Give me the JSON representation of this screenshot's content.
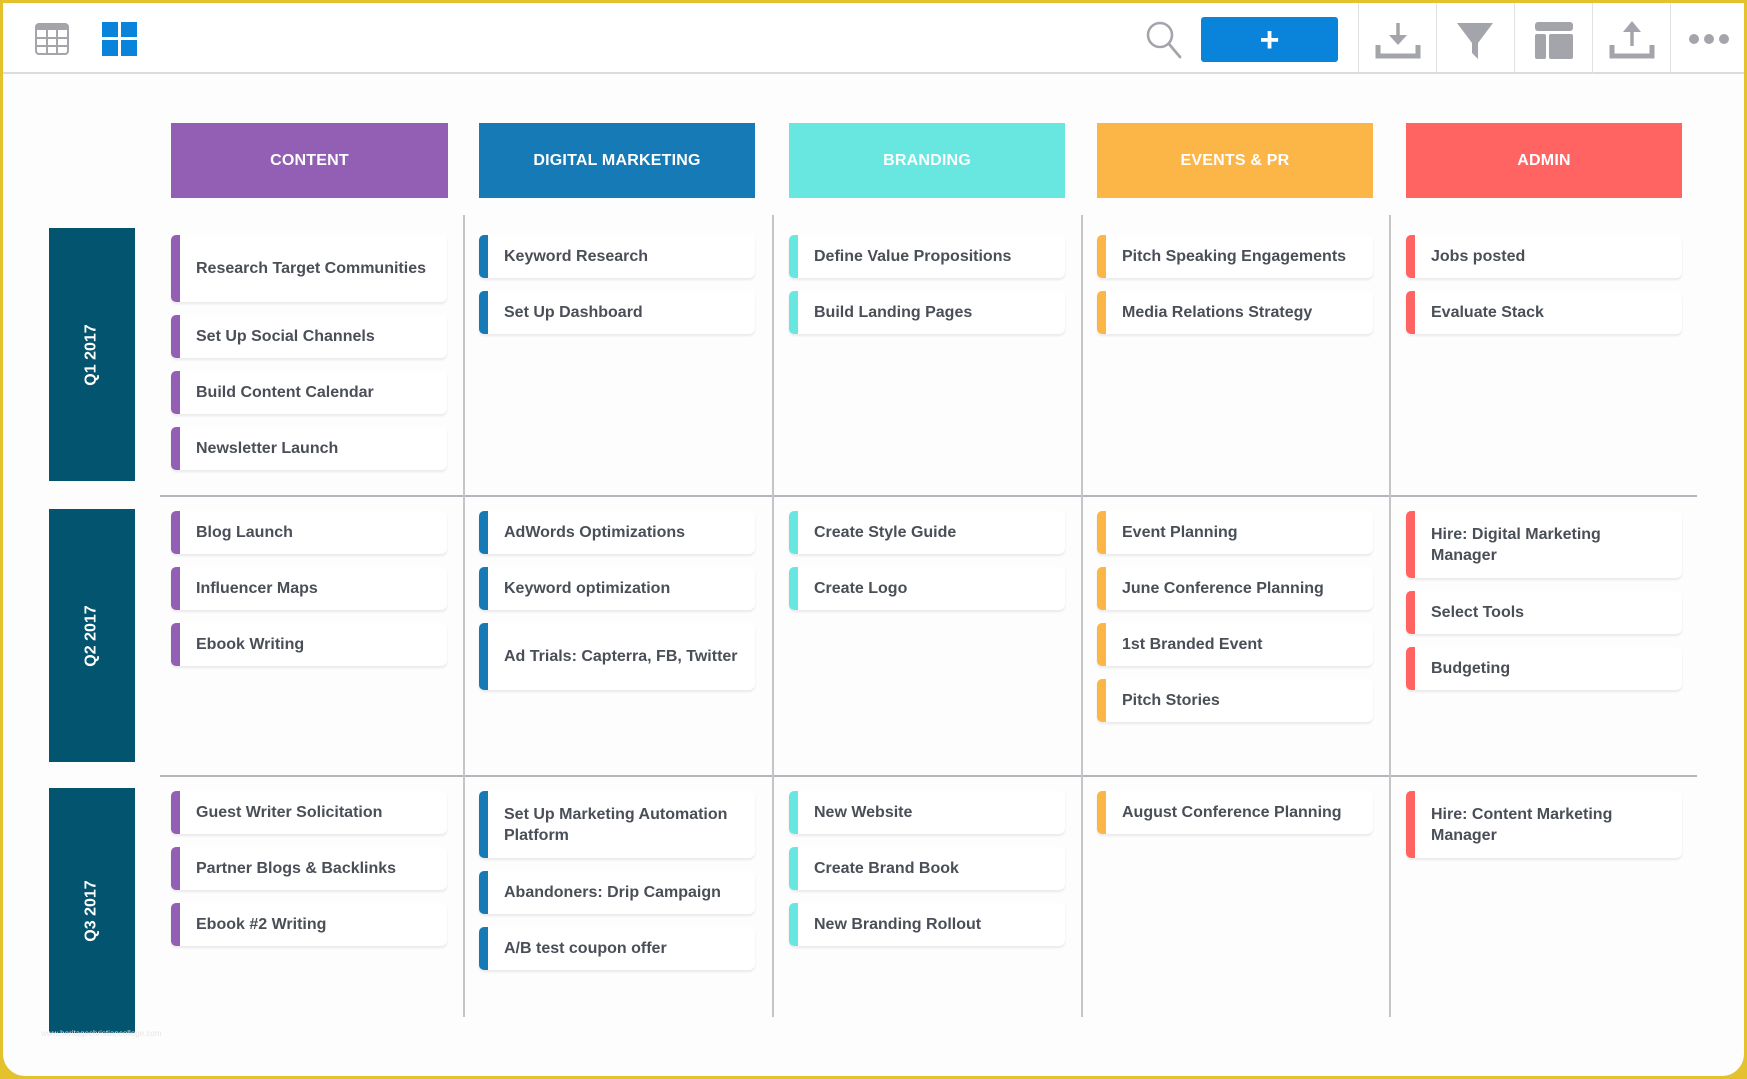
{
  "toolbar": {
    "grid_view_icon": "table-grid-icon",
    "board_view_icon": "board-tiles-icon",
    "search_icon": "search-icon",
    "add_label": "+",
    "download_icon": "download-icon",
    "filter_icon": "filter-icon",
    "layout_icon": "layout-icon",
    "upload_icon": "upload-icon",
    "more_icon": "more-dots-icon"
  },
  "colors": {
    "content": "#935fb4",
    "digital_marketing": "#167ab6",
    "branding": "#68e7e1",
    "events_pr": "#fcb647",
    "admin": "#ff6462",
    "quarter": "#03546f",
    "add_button": "#0a84db"
  },
  "columns": [
    {
      "key": "content",
      "label": "CONTENT"
    },
    {
      "key": "digital_marketing",
      "label": "DIGITAL MARKETING"
    },
    {
      "key": "branding",
      "label": "BRANDING"
    },
    {
      "key": "events_pr",
      "label": "EVENTS & PR"
    },
    {
      "key": "admin",
      "label": "ADMIN"
    }
  ],
  "rows": [
    {
      "label": "Q1 2017",
      "cells": [
        [
          "Research Target Communities",
          "Set Up Social Channels",
          "Build Content Calendar",
          "Newsletter Launch"
        ],
        [
          "Keyword Research",
          "Set Up Dashboard"
        ],
        [
          "Define Value Propositions",
          "Build Landing Pages"
        ],
        [
          "Pitch Speaking Engagements",
          "Media Relations Strategy"
        ],
        [
          "Jobs posted",
          "Evaluate Stack"
        ]
      ]
    },
    {
      "label": "Q2 2017",
      "cells": [
        [
          "Blog Launch",
          "Influencer Maps",
          "Ebook Writing"
        ],
        [
          "AdWords Optimizations",
          "Keyword optimization",
          "Ad Trials: Capterra, FB, Twitter"
        ],
        [
          "Create Style Guide",
          "Create Logo"
        ],
        [
          "Event Planning",
          "June Conference Planning",
          "1st Branded Event",
          "Pitch Stories"
        ],
        [
          "Hire: Digital Marketing Manager",
          "Select Tools",
          "Budgeting"
        ]
      ]
    },
    {
      "label": "Q3 2017",
      "cells": [
        [
          "Guest Writer Solicitation",
          "Partner Blogs & Backlinks",
          "Ebook #2 Writing"
        ],
        [
          "Set Up Marketing Automation Platform",
          "Abandoners: Drip Campaign",
          "A/B test coupon offer"
        ],
        [
          "New Website",
          "Create Brand Book",
          "New Branding Rollout"
        ],
        [
          "August Conference Planning"
        ],
        [
          "Hire: Content Marketing Manager"
        ]
      ]
    }
  ],
  "watermark": "www.heritagechristiancollege.com"
}
